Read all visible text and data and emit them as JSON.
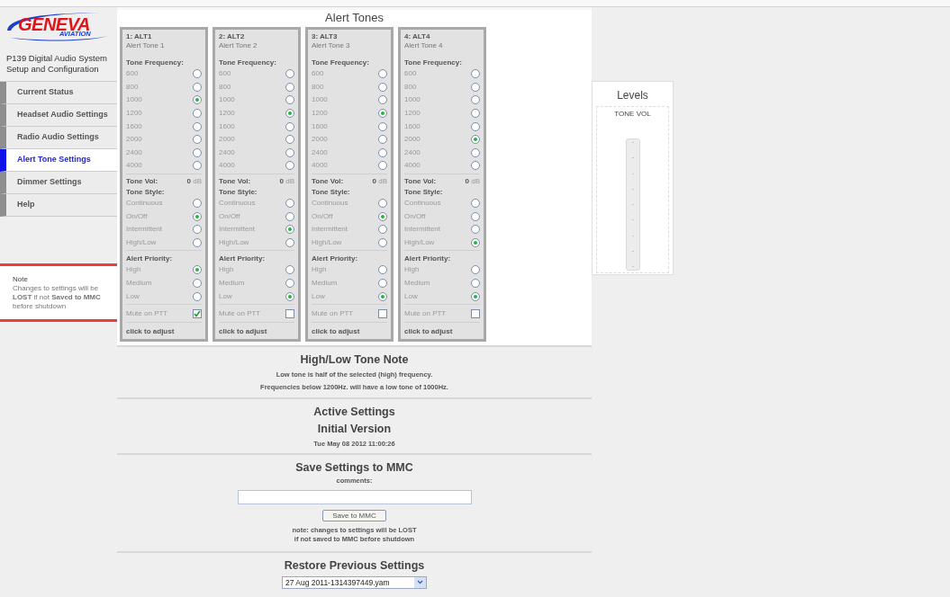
{
  "logo": {
    "main": "GENEVA",
    "sub": "AVIATION"
  },
  "product": "P139 Digital Audio System Setup and Configuration",
  "nav": [
    {
      "label": "Current Status",
      "selected": false
    },
    {
      "label": "Headset Audio Settings",
      "selected": false
    },
    {
      "label": "Radio Audio Settings",
      "selected": false
    },
    {
      "label": "Alert Tone Settings",
      "selected": true
    },
    {
      "label": "Dimmer Settings",
      "selected": false
    },
    {
      "label": "Help",
      "selected": false
    }
  ],
  "note": {
    "title": "Note",
    "text": "Changes to settings will be **LOST** if not **Saved to MMC** before shutdown"
  },
  "alert_tones": {
    "title": "Alert Tones",
    "tones": [
      {
        "id": "1: ALT1",
        "name": "Alert Tone 1",
        "freq_label": "Tone Frequency:",
        "frequencies": [
          {
            "label": "600",
            "selected": false
          },
          {
            "label": "800",
            "selected": false
          },
          {
            "label": "1000",
            "selected": true
          },
          {
            "label": "1200",
            "selected": false
          },
          {
            "label": "1600",
            "selected": false
          },
          {
            "label": "2000",
            "selected": false
          },
          {
            "label": "2400",
            "selected": false
          },
          {
            "label": "4000",
            "selected": false
          }
        ],
        "vol_label": "Tone Vol:",
        "vol_value": "0",
        "vol_unit": "dB",
        "style_label": "Tone Style:",
        "styles": [
          {
            "label": "Continuous",
            "selected": false
          },
          {
            "label": "On/Off",
            "selected": true
          },
          {
            "label": "Intermittent",
            "selected": false
          },
          {
            "label": "High/Low",
            "selected": false
          }
        ],
        "priority_label": "Alert Priority:",
        "priorities": [
          {
            "label": "High",
            "selected": true
          },
          {
            "label": "Medium",
            "selected": false
          },
          {
            "label": "Low",
            "selected": false
          }
        ],
        "mute": {
          "label": "Mute on PTT",
          "checked": true
        },
        "footer": "click to adjust"
      },
      {
        "id": "2: ALT2",
        "name": "Alert Tone 2",
        "freq_label": "Tone Frequency:",
        "frequencies": [
          {
            "label": "600",
            "selected": false
          },
          {
            "label": "800",
            "selected": false
          },
          {
            "label": "1000",
            "selected": false
          },
          {
            "label": "1200",
            "selected": true
          },
          {
            "label": "1600",
            "selected": false
          },
          {
            "label": "2000",
            "selected": false
          },
          {
            "label": "2400",
            "selected": false
          },
          {
            "label": "4000",
            "selected": false
          }
        ],
        "vol_label": "Tone Vol:",
        "vol_value": "0",
        "vol_unit": "dB",
        "style_label": "Tone Style:",
        "styles": [
          {
            "label": "Continuous",
            "selected": false
          },
          {
            "label": "On/Off",
            "selected": false
          },
          {
            "label": "Intermittent",
            "selected": true
          },
          {
            "label": "High/Low",
            "selected": false
          }
        ],
        "priority_label": "Alert Priority:",
        "priorities": [
          {
            "label": "High",
            "selected": false
          },
          {
            "label": "Medium",
            "selected": false
          },
          {
            "label": "Low",
            "selected": true
          }
        ],
        "mute": {
          "label": "Mute on PTT",
          "checked": false
        },
        "footer": "click to adjust"
      },
      {
        "id": "3: ALT3",
        "name": "Alert Tone 3",
        "freq_label": "Tone Frequency:",
        "frequencies": [
          {
            "label": "600",
            "selected": false
          },
          {
            "label": "800",
            "selected": false
          },
          {
            "label": "1000",
            "selected": false
          },
          {
            "label": "1200",
            "selected": true
          },
          {
            "label": "1600",
            "selected": false
          },
          {
            "label": "2000",
            "selected": false
          },
          {
            "label": "2400",
            "selected": false
          },
          {
            "label": "4000",
            "selected": false
          }
        ],
        "vol_label": "Tone Vol:",
        "vol_value": "0",
        "vol_unit": "dB",
        "style_label": "Tone Style:",
        "styles": [
          {
            "label": "Continuous",
            "selected": false
          },
          {
            "label": "On/Off",
            "selected": true
          },
          {
            "label": "Intermittent",
            "selected": false
          },
          {
            "label": "High/Low",
            "selected": false
          }
        ],
        "priority_label": "Alert Priority:",
        "priorities": [
          {
            "label": "High",
            "selected": false
          },
          {
            "label": "Medium",
            "selected": false
          },
          {
            "label": "Low",
            "selected": true
          }
        ],
        "mute": {
          "label": "Mute on PTT",
          "checked": false
        },
        "footer": "click to adjust"
      },
      {
        "id": "4: ALT4",
        "name": "Alert Tone 4",
        "freq_label": "Tone Frequency:",
        "frequencies": [
          {
            "label": "600",
            "selected": false
          },
          {
            "label": "800",
            "selected": false
          },
          {
            "label": "1000",
            "selected": false
          },
          {
            "label": "1200",
            "selected": false
          },
          {
            "label": "1600",
            "selected": false
          },
          {
            "label": "2000",
            "selected": true
          },
          {
            "label": "2400",
            "selected": false
          },
          {
            "label": "4000",
            "selected": false
          }
        ],
        "vol_label": "Tone Vol:",
        "vol_value": "0",
        "vol_unit": "dB",
        "style_label": "Tone Style:",
        "styles": [
          {
            "label": "Continuous",
            "selected": false
          },
          {
            "label": "On/Off",
            "selected": false
          },
          {
            "label": "Intermittent",
            "selected": false
          },
          {
            "label": "High/Low",
            "selected": true
          }
        ],
        "priority_label": "Alert Priority:",
        "priorities": [
          {
            "label": "High",
            "selected": false
          },
          {
            "label": "Medium",
            "selected": false
          },
          {
            "label": "Low",
            "selected": true
          }
        ],
        "mute": {
          "label": "Mute on PTT",
          "checked": false
        },
        "footer": "click to adjust"
      }
    ]
  },
  "high_low_note": {
    "title": "High/Low Tone Note",
    "lines": [
      "Low tone is half of the selected (high) frequency.",
      "Frequencies below 1200Hz. will have a low tone of 1000Hz."
    ]
  },
  "active_settings": {
    "title": "Active Settings",
    "version": "Initial Version",
    "date": "Tue May 08 2012 11:00:26"
  },
  "save": {
    "title": "Save Settings to MMC",
    "comments_label": "comments:",
    "button": "Save to MMC",
    "note_lines": [
      "note: changes to settings will be LOST",
      "if not saved to MMC before shutdown"
    ]
  },
  "restore": {
    "title": "Restore Previous Settings",
    "selected_file": "27 Aug 2011-1314397449.yam"
  },
  "levels": {
    "title": "Levels",
    "meter_label": "TONE VOL"
  }
}
